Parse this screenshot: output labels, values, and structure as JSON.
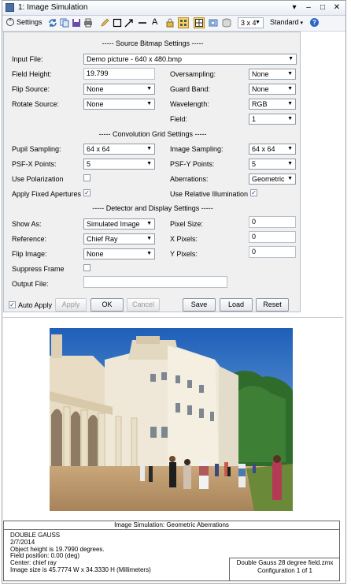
{
  "window": {
    "title": "1: Image Simulation"
  },
  "toolbar": {
    "settings_label": "Settings",
    "layout_value": "3 x 4",
    "view_value": "Standard"
  },
  "sections": {
    "source": "----- Source Bitmap Settings -----",
    "conv": "----- Convolution Grid Settings -----",
    "detector": "----- Detector and Display Settings -----"
  },
  "source": {
    "input_file_label": "Input File:",
    "input_file": "Demo picture -  640 x 480.bmp",
    "field_height_label": "Field Height:",
    "field_height": "19.799",
    "oversampling_label": "Oversampling:",
    "oversampling": "None",
    "flip_source_label": "Flip Source:",
    "flip_source": "None",
    "guard_band_label": "Guard Band:",
    "guard_band": "None",
    "rotate_source_label": "Rotate Source:",
    "rotate_source": "None",
    "wavelength_label": "Wavelength:",
    "wavelength": "RGB",
    "field_label": "Field:",
    "field": "1"
  },
  "conv": {
    "pupil_sampling_label": "Pupil Sampling:",
    "pupil_sampling": "64 x 64",
    "image_sampling_label": "Image Sampling:",
    "image_sampling": "64 x 64",
    "psfx_label": "PSF-X Points:",
    "psfx": "5",
    "psfy_label": "PSF-Y Points:",
    "psfy": "5",
    "use_polarization_label": "Use Polarization",
    "aberrations_label": "Aberrations:",
    "aberrations": "Geometric",
    "fixed_apertures_label": "Apply Fixed Apertures",
    "relative_illum_label": "Use Relative Illumination"
  },
  "detector": {
    "show_as_label": "Show As:",
    "show_as": "Simulated Image",
    "pixel_size_label": "Pixel Size:",
    "pixel_size": "0",
    "reference_label": "Reference:",
    "reference": "Chief Ray",
    "x_pixels_label": "X Pixels:",
    "x_pixels": "0",
    "flip_image_label": "Flip Image:",
    "flip_image": "None",
    "y_pixels_label": "Y Pixels:",
    "y_pixels": "0",
    "suppress_frame_label": "Suppress Frame",
    "output_file_label": "Output File:",
    "output_file": ""
  },
  "buttons": {
    "auto_apply": "Auto Apply",
    "apply": "Apply",
    "ok": "OK",
    "cancel": "Cancel",
    "save": "Save",
    "load": "Load",
    "reset": "Reset"
  },
  "info": {
    "header": "Image Simulation: Geometric Aberrations",
    "line1": "DOUBLE GAUSS",
    "line2": "2/7/2014",
    "line3": "Object height is 19.7990 degrees.",
    "line4": "Field position: 0.00 (deg)",
    "line5": "Center: chief ray",
    "line6": "Image size is 45.7774 W x 34.3330 H (Millimeters)",
    "file": "Double Gauss 28 degree field.zmx",
    "config": "Configuration 1 of 1"
  }
}
